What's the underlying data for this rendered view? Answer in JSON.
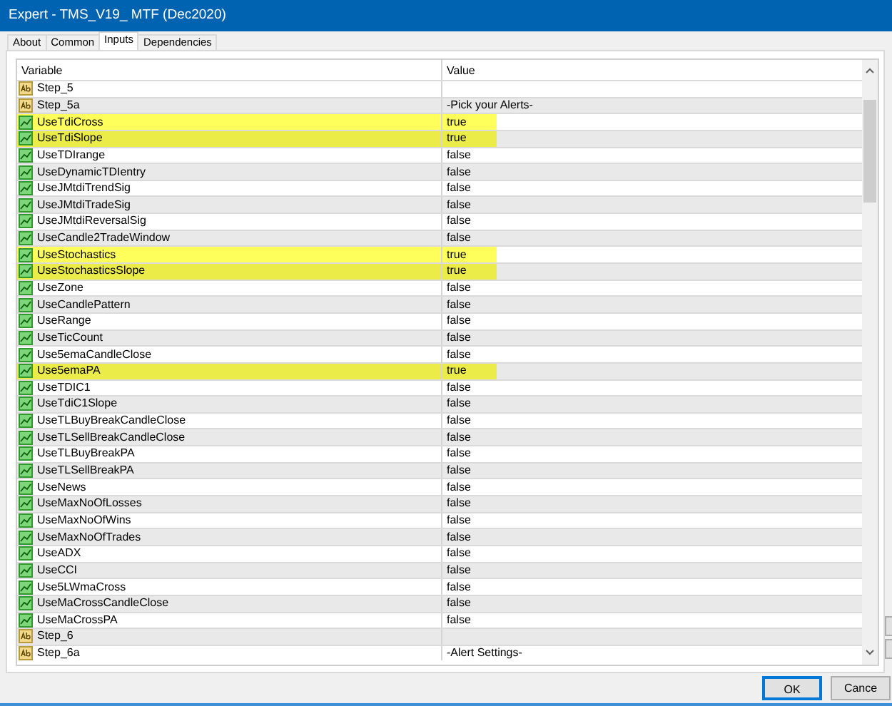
{
  "window": {
    "title": "Expert - TMS_V19_ MTF (Dec2020)"
  },
  "tabs": [
    {
      "label": "About",
      "selected": false
    },
    {
      "label": "Common",
      "selected": false
    },
    {
      "label": "Inputs",
      "selected": true
    },
    {
      "label": "Dependencies",
      "selected": false
    }
  ],
  "table": {
    "columns": [
      "Variable",
      "Value"
    ],
    "rows": [
      {
        "kind": "string",
        "variable": "Step_5",
        "value": "",
        "highlighted": false
      },
      {
        "kind": "string",
        "variable": "Step_5a",
        "value": "-Pick your Alerts-",
        "highlighted": false
      },
      {
        "kind": "bool",
        "variable": "UseTdiCross",
        "value": "true",
        "highlighted": true
      },
      {
        "kind": "bool",
        "variable": "UseTdiSlope",
        "value": "true",
        "highlighted": true
      },
      {
        "kind": "bool",
        "variable": "UseTDIrange",
        "value": "false",
        "highlighted": false
      },
      {
        "kind": "bool",
        "variable": "UseDynamicTDIentry",
        "value": "false",
        "highlighted": false
      },
      {
        "kind": "bool",
        "variable": "UseJMtdiTrendSig",
        "value": "false",
        "highlighted": false
      },
      {
        "kind": "bool",
        "variable": "UseJMtdiTradeSig",
        "value": "false",
        "highlighted": false
      },
      {
        "kind": "bool",
        "variable": "UseJMtdiReversalSig",
        "value": "false",
        "highlighted": false
      },
      {
        "kind": "bool",
        "variable": "UseCandle2TradeWindow",
        "value": "false",
        "highlighted": false
      },
      {
        "kind": "bool",
        "variable": "UseStochastics",
        "value": "true",
        "highlighted": true
      },
      {
        "kind": "bool",
        "variable": "UseStochasticsSlope",
        "value": "true",
        "highlighted": true
      },
      {
        "kind": "bool",
        "variable": "UseZone",
        "value": "false",
        "highlighted": false
      },
      {
        "kind": "bool",
        "variable": "UseCandlePattern",
        "value": "false",
        "highlighted": false
      },
      {
        "kind": "bool",
        "variable": "UseRange",
        "value": "false",
        "highlighted": false
      },
      {
        "kind": "bool",
        "variable": "UseTicCount",
        "value": "false",
        "highlighted": false
      },
      {
        "kind": "bool",
        "variable": "Use5emaCandleClose",
        "value": "false",
        "highlighted": false
      },
      {
        "kind": "bool",
        "variable": "Use5emaPA",
        "value": "true",
        "highlighted": true
      },
      {
        "kind": "bool",
        "variable": "UseTDIC1",
        "value": "false",
        "highlighted": false
      },
      {
        "kind": "bool",
        "variable": "UseTdiC1Slope",
        "value": "false",
        "highlighted": false
      },
      {
        "kind": "bool",
        "variable": "UseTLBuyBreakCandleClose",
        "value": "false",
        "highlighted": false
      },
      {
        "kind": "bool",
        "variable": "UseTLSellBreakCandleClose",
        "value": "false",
        "highlighted": false
      },
      {
        "kind": "bool",
        "variable": "UseTLBuyBreakPA",
        "value": "false",
        "highlighted": false
      },
      {
        "kind": "bool",
        "variable": "UseTLSellBreakPA",
        "value": "false",
        "highlighted": false
      },
      {
        "kind": "bool",
        "variable": "UseNews",
        "value": "false",
        "highlighted": false
      },
      {
        "kind": "bool",
        "variable": "UseMaxNoOfLosses",
        "value": "false",
        "highlighted": false
      },
      {
        "kind": "bool",
        "variable": "UseMaxNoOfWins",
        "value": "false",
        "highlighted": false
      },
      {
        "kind": "bool",
        "variable": "UseMaxNoOfTrades",
        "value": "false",
        "highlighted": false
      },
      {
        "kind": "bool",
        "variable": "UseADX",
        "value": "false",
        "highlighted": false
      },
      {
        "kind": "bool",
        "variable": "UseCCI",
        "value": "false",
        "highlighted": false
      },
      {
        "kind": "bool",
        "variable": "Use5LWmaCross",
        "value": "false",
        "highlighted": false
      },
      {
        "kind": "bool",
        "variable": "UseMaCrossCandleClose",
        "value": "false",
        "highlighted": false
      },
      {
        "kind": "bool",
        "variable": "UseMaCrossPA",
        "value": "false",
        "highlighted": false
      },
      {
        "kind": "string",
        "variable": "Step_6",
        "value": "",
        "highlighted": false
      },
      {
        "kind": "string",
        "variable": "Step_6a",
        "value": "-Alert Settings-",
        "highlighted": false
      }
    ]
  },
  "buttons": [
    "OK",
    "Cance"
  ]
}
